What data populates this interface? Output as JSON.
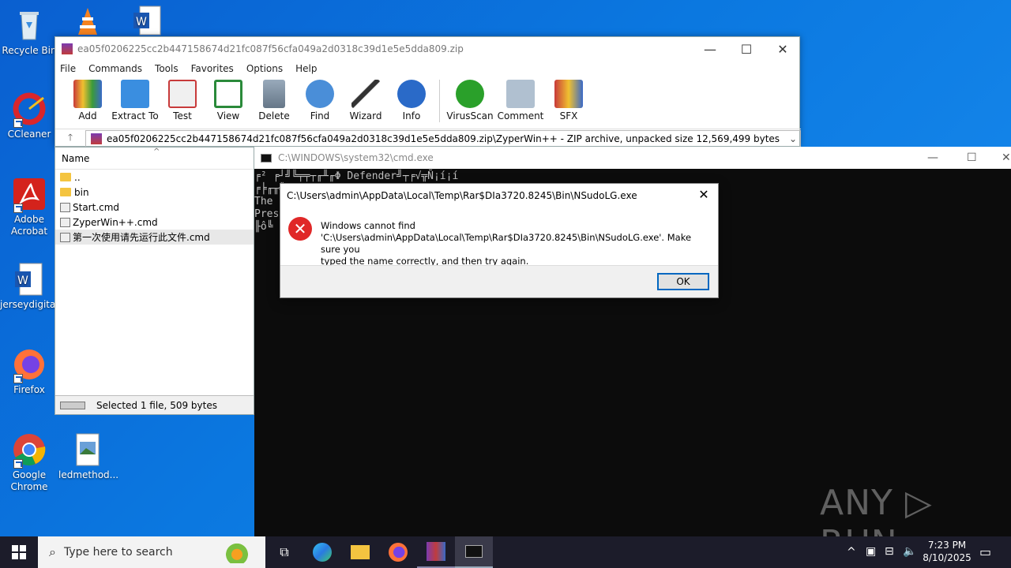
{
  "desktop": {
    "icons": [
      {
        "label": "Recycle Bin"
      },
      {
        "label": "CCleaner"
      },
      {
        "label": "Adobe Acrobat"
      },
      {
        "label": "jerseydigita..."
      },
      {
        "label": "Firefox"
      },
      {
        "label": "Google Chrome"
      },
      {
        "label": "ledmethod..."
      }
    ]
  },
  "winrar": {
    "title": "ea05f0206225cc2b447158674d21fc087f56cfa049a2d0318c39d1e5e5dda809.zip",
    "menu": [
      "File",
      "Commands",
      "Tools",
      "Favorites",
      "Options",
      "Help"
    ],
    "toolbar": [
      "Add",
      "Extract To",
      "Test",
      "View",
      "Delete",
      "Find",
      "Wizard",
      "Info",
      "VirusScan",
      "Comment",
      "SFX"
    ],
    "address": "ea05f0206225cc2b447158674d21fc087f56cfa049a2d0318c39d1e5e5dda809.zip\\ZyperWin++ - ZIP archive, unpacked size 12,569,499 bytes",
    "column_name": "Name",
    "files": [
      "..",
      "bin",
      "Start.cmd",
      "ZyperWin++.cmd",
      "第一次使用请先运行此文件.cmd"
    ],
    "status": "Selected 1 file, 509 bytes"
  },
  "cmd": {
    "title": "C:\\WINDOWS\\system32\\cmd.exe",
    "lines": [
      "╒² ╒┘╝╚╤╤┬╓╨╓Φ Defender╝┬╒√╦Ñ¡í¡í",
      "╒╞╓╥╣",
      "The",
      "Pres",
      "╟ô╚"
    ]
  },
  "dialog": {
    "title": "C:\\Users\\admin\\AppData\\Local\\Temp\\Rar$DIa3720.8245\\Bin\\NSudoLG.exe",
    "line1": "Windows cannot find",
    "line2": "'C:\\Users\\admin\\AppData\\Local\\Temp\\Rar$DIa3720.8245\\Bin\\NSudoLG.exe'. Make sure you",
    "line3": "typed the name correctly, and then try again.",
    "ok": "OK"
  },
  "watermark": "ANY ▷ RUN",
  "taskbar": {
    "search_placeholder": "Type here to search",
    "time": "7:23 PM",
    "date": "8/10/2025"
  }
}
